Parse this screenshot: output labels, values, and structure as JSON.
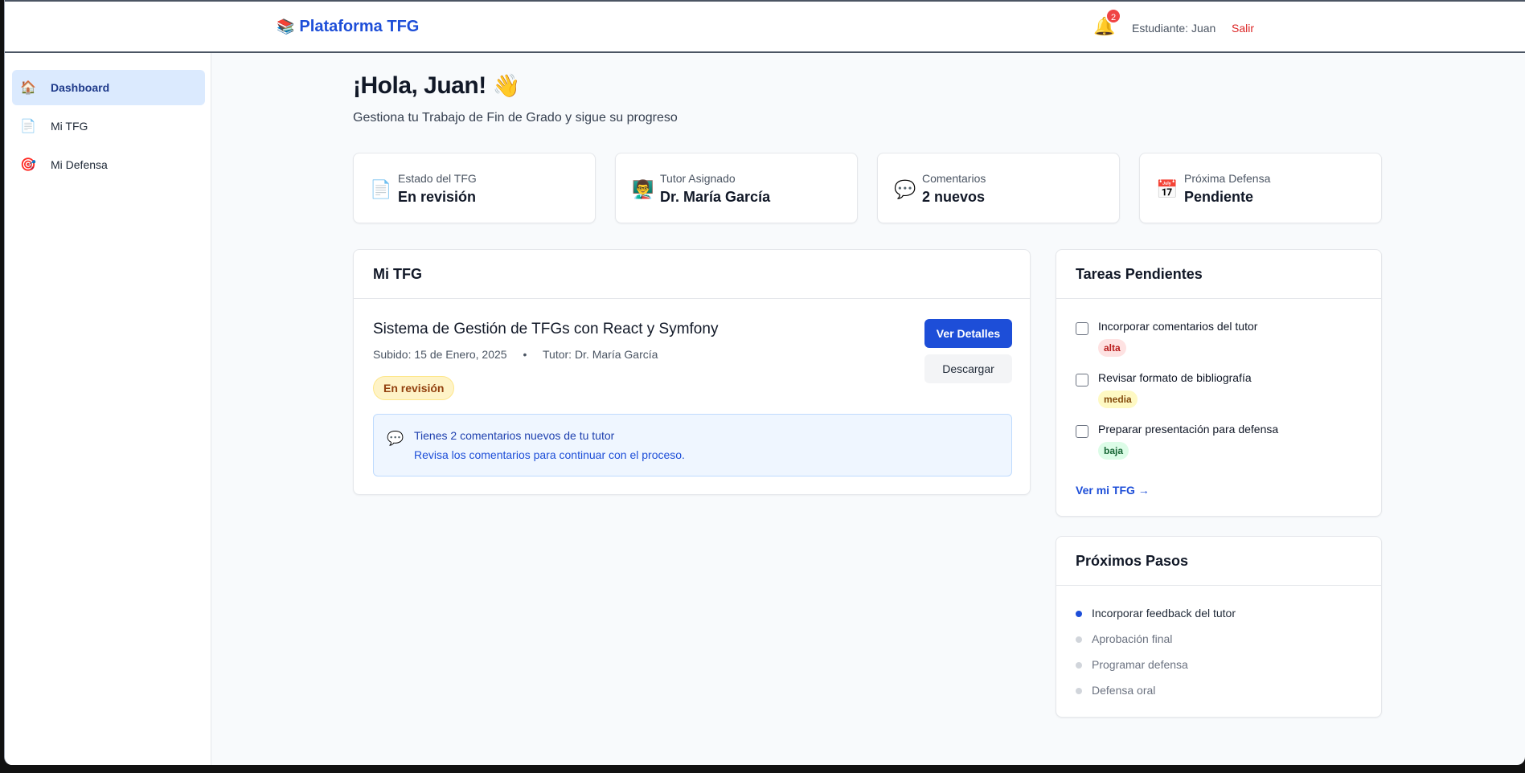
{
  "header": {
    "brand_icon": "books-icon",
    "brand": "Plataforma TFG",
    "notification_count": "2",
    "user_label": "Estudiante: Juan",
    "logout": "Salir"
  },
  "sidebar": {
    "items": [
      {
        "label": "Dashboard",
        "icon": "🏠",
        "active": true
      },
      {
        "label": "Mi TFG",
        "icon": "📄",
        "active": false
      },
      {
        "label": "Mi Defensa",
        "icon": "🎯",
        "active": false
      }
    ]
  },
  "main": {
    "greeting": "¡Hola, Juan!",
    "greeting_emoji": "👋",
    "subtitle": "Gestiona tu Trabajo de Fin de Grado y sigue su progreso"
  },
  "stats": [
    {
      "icon": "📄",
      "label": "Estado del TFG",
      "value": "En revisión"
    },
    {
      "icon": "👨‍🏫",
      "label": "Tutor Asignado",
      "value": "Dr. María García"
    },
    {
      "icon": "💬",
      "label": "Comentarios",
      "value": "2 nuevos"
    },
    {
      "icon": "📅",
      "label": "Próxima Defensa",
      "value": "Pendiente"
    }
  ],
  "tfg_card": {
    "heading": "Mi TFG",
    "title": "Sistema de Gestión de TFGs con React y Symfony",
    "uploaded": "Subido: 15 de Enero, 2025",
    "separator": "•",
    "tutor": "Tutor: Dr. María García",
    "status": "En revisión",
    "details_button": "Ver Detalles",
    "download_button": "Descargar",
    "notice_title": "Tienes 2 comentarios nuevos de tu tutor",
    "notice_body": "Revisa los comentarios para continuar con el proceso."
  },
  "tasks": {
    "heading": "Tareas Pendientes",
    "items": [
      {
        "label": "Incorporar comentarios del tutor",
        "priority": "alta"
      },
      {
        "label": "Revisar formato de bibliografía",
        "priority": "media"
      },
      {
        "label": "Preparar presentación para defensa",
        "priority": "baja"
      }
    ],
    "link": "Ver mi TFG →"
  },
  "next_steps": {
    "heading": "Próximos Pasos",
    "items": [
      {
        "label": "Incorporar feedback del tutor",
        "current": true
      },
      {
        "label": "Aprobación final",
        "current": false
      },
      {
        "label": "Programar defensa",
        "current": false
      },
      {
        "label": "Defensa oral",
        "current": false
      }
    ]
  },
  "colors": {
    "accent": "#1d4ed8",
    "danger": "#dc2626",
    "warning_bg": "#fef3c7",
    "info_bg": "#eff6ff"
  }
}
